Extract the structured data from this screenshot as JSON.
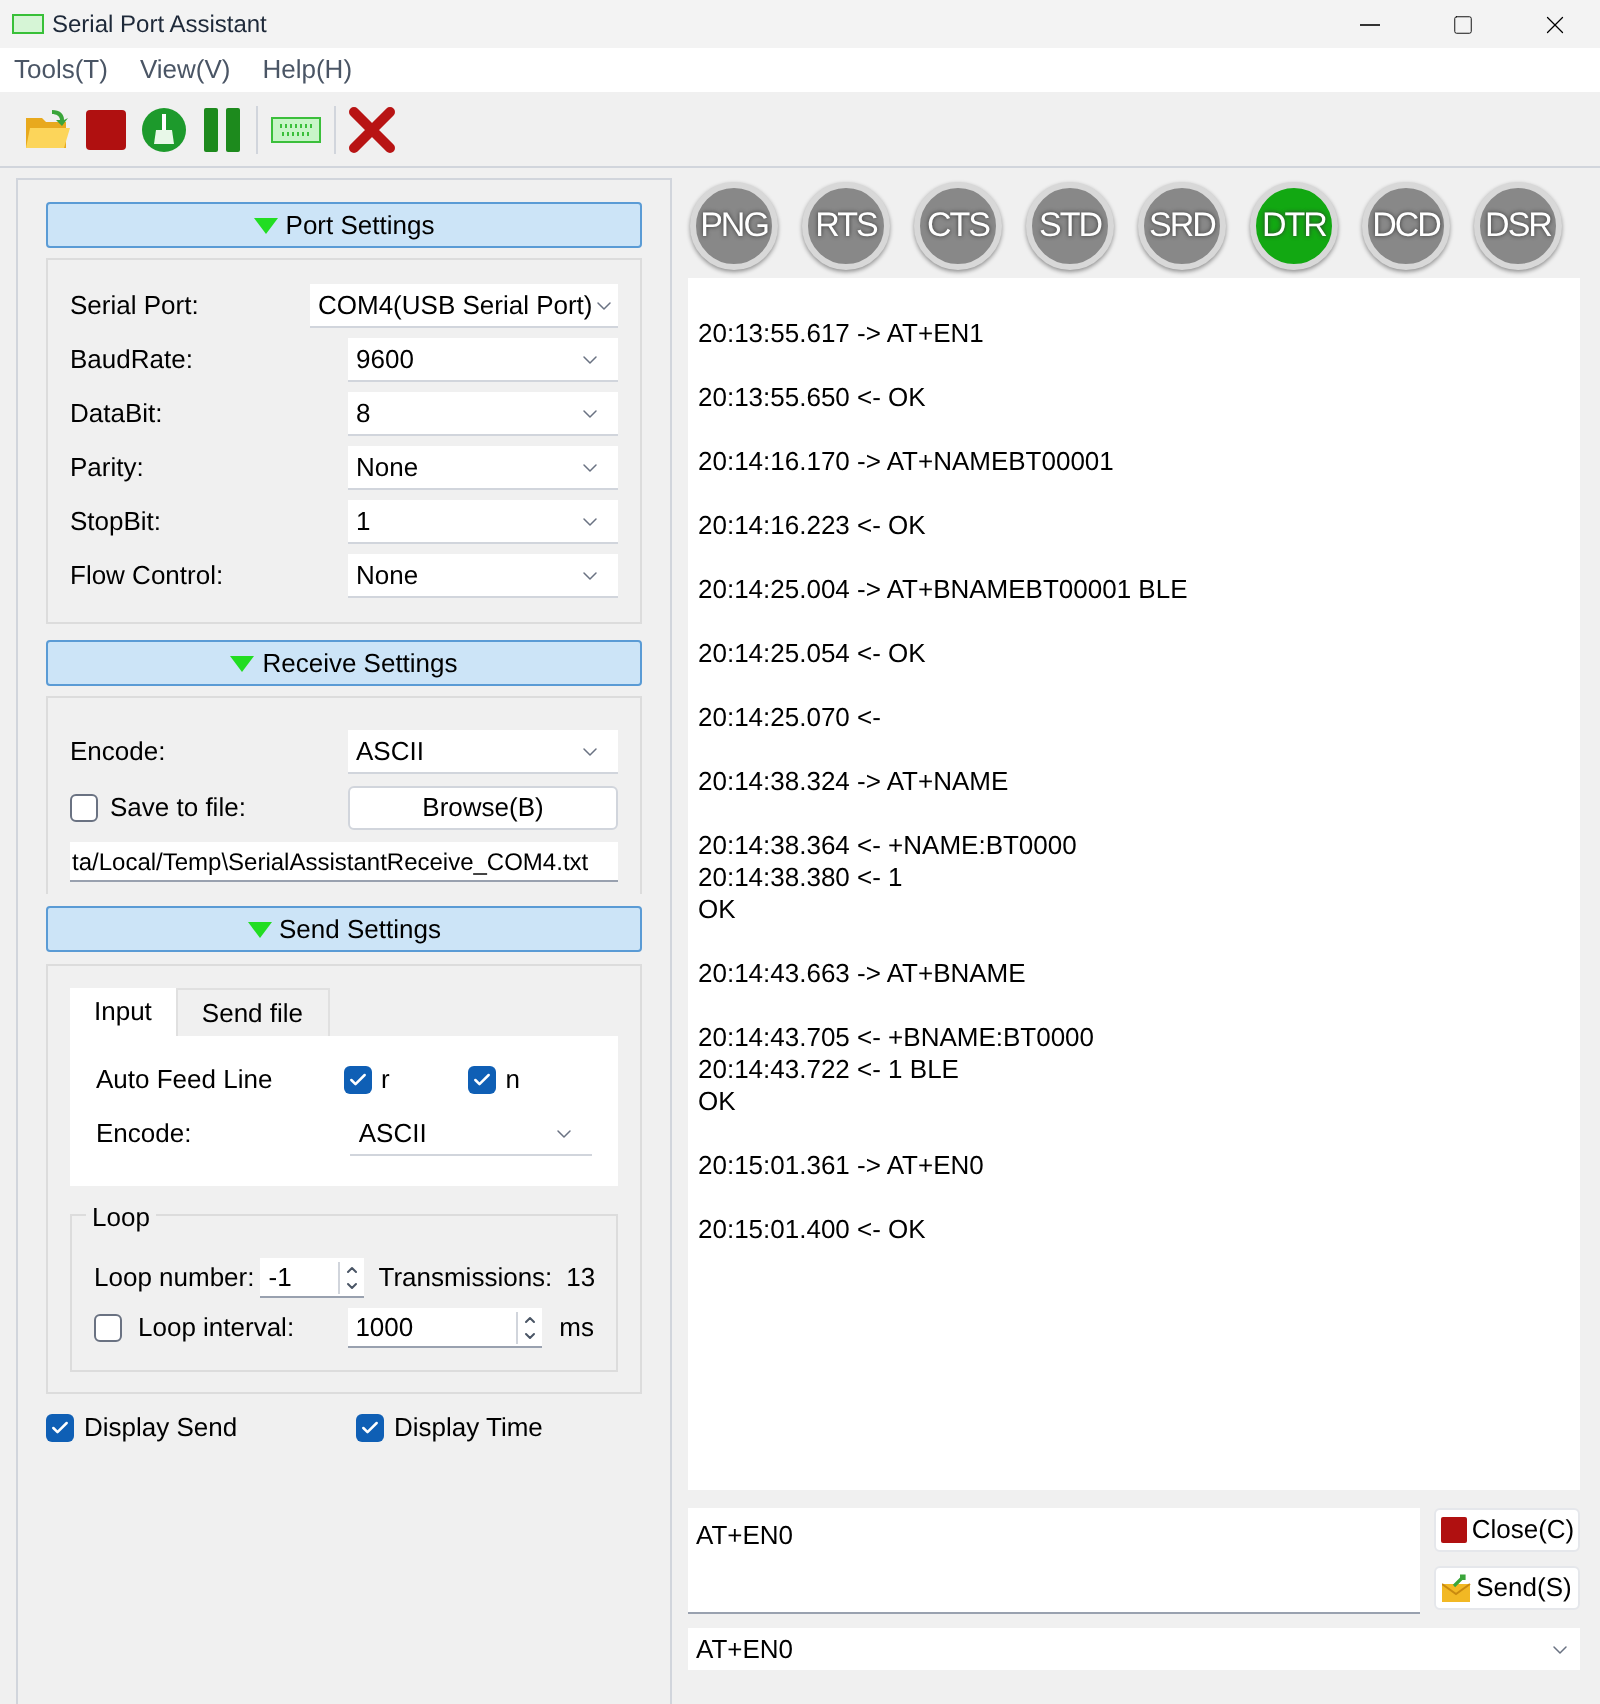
{
  "window": {
    "title": "Serial Port Assistant"
  },
  "menu": [
    "Tools(T)",
    "View(V)",
    "Help(H)"
  ],
  "port_settings": {
    "title": "Port Settings",
    "fields": [
      {
        "label": "Serial Port:",
        "value": "COM4(USB Serial Port)",
        "kind": "wide"
      },
      {
        "label": "BaudRate:",
        "value": "9600",
        "kind": "normal"
      },
      {
        "label": "DataBit:",
        "value": "8",
        "kind": "normal"
      },
      {
        "label": "Parity:",
        "value": "None",
        "kind": "normal"
      },
      {
        "label": "StopBit:",
        "value": "1",
        "kind": "normal"
      },
      {
        "label": "Flow Control:",
        "value": "None",
        "kind": "normal"
      }
    ]
  },
  "receive_settings": {
    "title": "Receive Settings",
    "encode": {
      "label": "Encode:",
      "value": "ASCII"
    },
    "save_to_file": {
      "label": "Save to file:",
      "checked": false
    },
    "browse_button": "Browse(B)",
    "path": "ta/Local/Temp\\SerialAssistantReceive_COM4.txt"
  },
  "send_settings": {
    "title": "Send Settings",
    "tabs": [
      {
        "label": "Input",
        "selected": true
      },
      {
        "label": "Send file",
        "selected": false
      }
    ],
    "auto_feed": {
      "label": "Auto Feed Line",
      "options": [
        {
          "label": "r",
          "checked": true
        },
        {
          "label": "n",
          "checked": true
        }
      ]
    },
    "encode": {
      "label": "Encode:",
      "value": "ASCII"
    },
    "loop": {
      "title": "Loop",
      "number_label": "Loop number:",
      "number_value": "-1",
      "transmissions_label": "Transmissions:",
      "transmissions_value": "13",
      "interval": {
        "label": "Loop interval:",
        "checked": false,
        "value": "1000",
        "unit": "ms"
      }
    }
  },
  "display_options": [
    {
      "label": "Display Send",
      "checked": true
    },
    {
      "label": "Display Time",
      "checked": true
    }
  ],
  "signals": [
    {
      "label": "PNG",
      "on": false
    },
    {
      "label": "RTS",
      "on": false
    },
    {
      "label": "CTS",
      "on": false
    },
    {
      "label": "STD",
      "on": false
    },
    {
      "label": "SRD",
      "on": false
    },
    {
      "label": "DTR",
      "on": true
    },
    {
      "label": "DCD",
      "on": false
    },
    {
      "label": "DSR",
      "on": false
    }
  ],
  "log": [
    [
      "20:13:55.617 -> AT+EN1"
    ],
    [
      "20:13:55.650 <- OK"
    ],
    [
      "20:14:16.170 -> AT+NAMEBT00001"
    ],
    [
      "20:14:16.223 <- OK"
    ],
    [
      "20:14:25.004 -> AT+BNAMEBT00001 BLE"
    ],
    [
      "20:14:25.054 <- OK"
    ],
    [
      "20:14:25.070 <-"
    ],
    [
      "20:14:38.324 -> AT+NAME"
    ],
    [
      "20:14:38.364 <- +NAME:BT0000",
      "20:14:38.380 <- 1",
      "OK"
    ],
    [
      "20:14:43.663 -> AT+BNAME"
    ],
    [
      "20:14:43.705 <- +BNAME:BT0000",
      "20:14:43.722 <- 1 BLE",
      "OK"
    ],
    [
      "20:15:01.361 -> AT+EN0"
    ],
    [
      "20:15:01.400 <- OK"
    ]
  ],
  "send_input": {
    "value": "AT+EN0"
  },
  "buttons": [
    {
      "kind": "close",
      "label": "Close(C)"
    },
    {
      "kind": "send",
      "label": "Send(S)"
    }
  ],
  "history": {
    "value": "AT+EN0"
  }
}
